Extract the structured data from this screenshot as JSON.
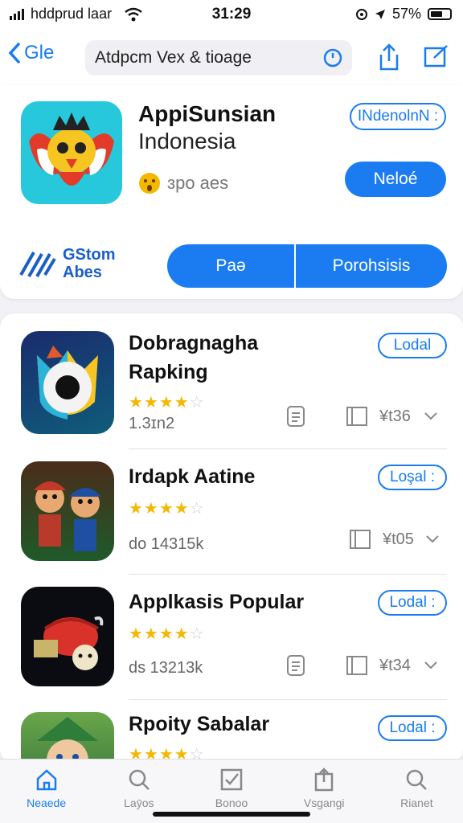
{
  "status_bar": {
    "carrier": "hddprud laar",
    "time": "31:29",
    "battery": "57%"
  },
  "nav": {
    "back_label": "Gle",
    "search_text": "Atdpcm Vex & tioage"
  },
  "featured": {
    "title": "AppiSunsian",
    "subtitle": "Indonesia",
    "meta": "ɜpo aes",
    "tag_label": "INdenolnN :",
    "action_label": "Neloé",
    "brand_line1": "GStom",
    "brand_line2": "Abes",
    "segments": [
      "Paə",
      "Porohsisis"
    ]
  },
  "list": [
    {
      "title_line1": "Dobragnagha",
      "title_line2": "Rapking",
      "rating": 4,
      "meta": "1.3ɪn2",
      "button": "Lodal",
      "price": "¥t36"
    },
    {
      "title_line1": "Irdapk Aatine",
      "title_line2": "",
      "rating": 4,
      "meta": "do 14315k",
      "button": "Loşal :",
      "price": "¥t05"
    },
    {
      "title_line1": "Applkasis Popular",
      "title_line2": "",
      "rating": 4,
      "meta": "ds 13213k",
      "button": "Lodal :",
      "price": "¥t34"
    },
    {
      "title_line1": "Rpoity Sabalar",
      "title_line2": "",
      "rating": 4,
      "meta": "",
      "button": "Lodal :",
      "price": ""
    }
  ],
  "tabs": [
    {
      "label": "Neaede",
      "icon": "house-icon",
      "active": true
    },
    {
      "label": "Laȳos",
      "icon": "search-icon",
      "active": false
    },
    {
      "label": "Bonoo",
      "icon": "checkbox-icon",
      "active": false
    },
    {
      "label": "Vsgangi",
      "icon": "share-icon",
      "active": false
    },
    {
      "label": "Rianet",
      "icon": "search-icon",
      "active": false
    }
  ],
  "colors": {
    "accent": "#1a7cf0",
    "star": "#f5b800"
  }
}
